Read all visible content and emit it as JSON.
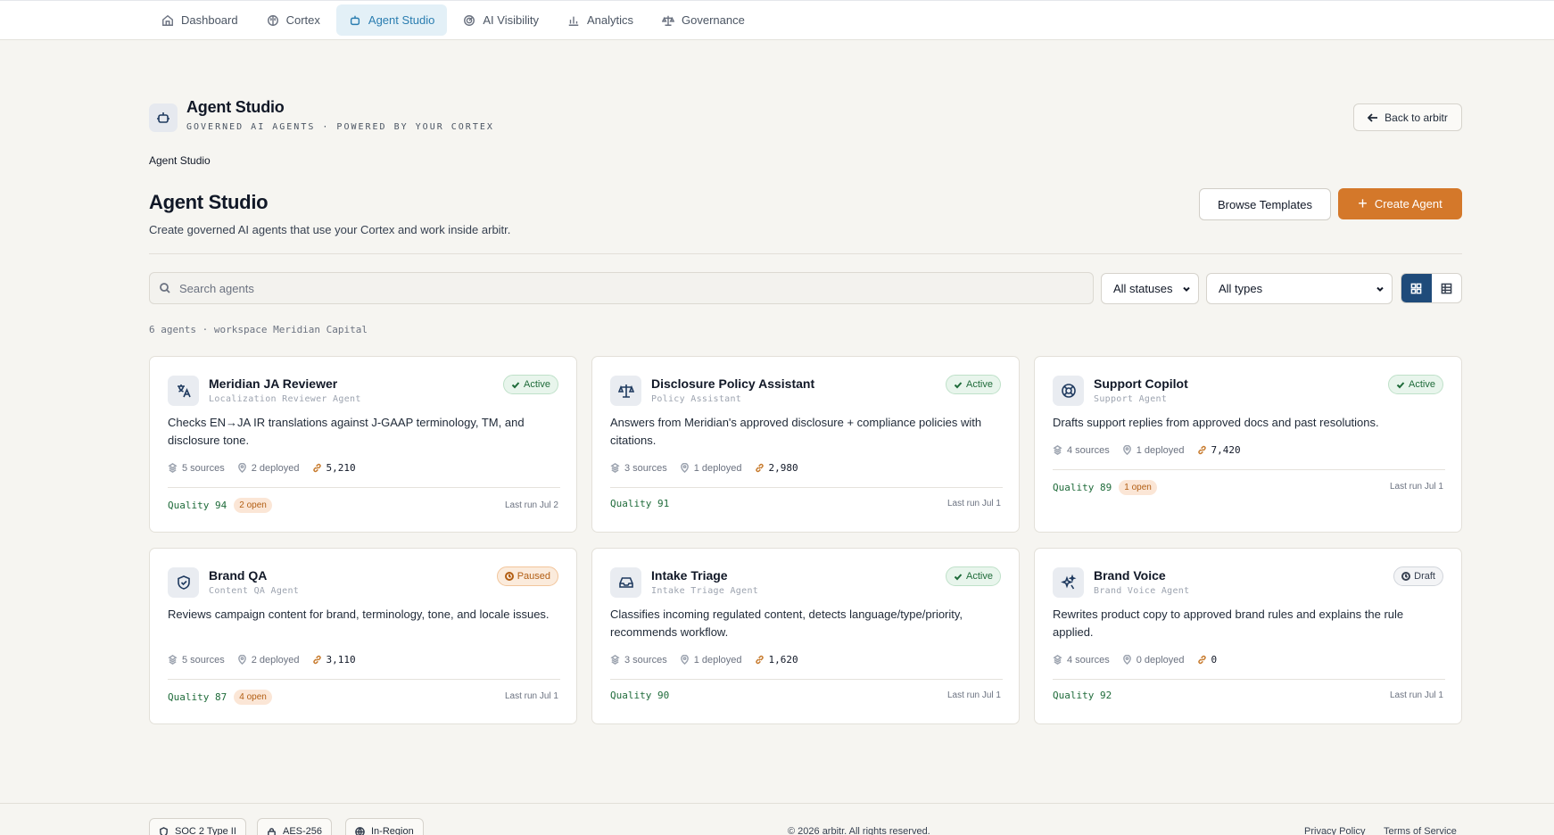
{
  "nav": {
    "items": [
      {
        "label": "Dashboard",
        "icon": "home-icon"
      },
      {
        "label": "Cortex",
        "icon": "brain-icon"
      },
      {
        "label": "Agent Studio",
        "icon": "bot-icon",
        "active": true
      },
      {
        "label": "AI Visibility",
        "icon": "radar-icon"
      },
      {
        "label": "Analytics",
        "icon": "bar-chart-icon"
      },
      {
        "label": "Governance",
        "icon": "scale-icon"
      }
    ]
  },
  "header": {
    "title": "Agent Studio",
    "subtitle": "GOVERNED AI AGENTS · POWERED BY YOUR CORTEX",
    "back_label": "Back to arbitr",
    "breadcrumb": "Agent Studio"
  },
  "main": {
    "title": "Agent Studio",
    "description": "Create governed AI agents that use your Cortex and work inside arbitr.",
    "browse_label": "Browse Templates",
    "create_label": "Create Agent"
  },
  "filters": {
    "search_placeholder": "Search agents",
    "status_value": "All statuses",
    "type_value": "All types",
    "view": "grid"
  },
  "summary": "6 agents · workspace Meridian Capital",
  "agents": [
    {
      "name": "Meridian JA Reviewer",
      "type": "Localization Reviewer Agent",
      "status": "Active",
      "icon": "translate-icon",
      "description": "Checks EN→JA IR translations against J-GAAP terminology, TM, and disclosure tone.",
      "sources": "5 sources",
      "deployed": "2 deployed",
      "runs": "5,210",
      "quality": "Quality 94",
      "open": "2 open",
      "last_run": "Last run Jul 2"
    },
    {
      "name": "Disclosure Policy Assistant",
      "type": "Policy Assistant",
      "status": "Active",
      "icon": "scale-icon",
      "description": "Answers from Meridian's approved disclosure + compliance policies with citations.",
      "sources": "3 sources",
      "deployed": "1 deployed",
      "runs": "2,980",
      "quality": "Quality 91",
      "open": "",
      "last_run": "Last run Jul 1"
    },
    {
      "name": "Support Copilot",
      "type": "Support Agent",
      "status": "Active",
      "icon": "lifebuoy-icon",
      "description": "Drafts support replies from approved docs and past resolutions.",
      "sources": "4 sources",
      "deployed": "1 deployed",
      "runs": "7,420",
      "quality": "Quality 89",
      "open": "1 open",
      "last_run": "Last run Jul 1"
    },
    {
      "name": "Brand QA",
      "type": "Content QA Agent",
      "status": "Paused",
      "icon": "shield-check-icon",
      "description": "Reviews campaign content for brand, terminology, tone, and locale issues.",
      "sources": "5 sources",
      "deployed": "2 deployed",
      "runs": "3,110",
      "quality": "Quality 87",
      "open": "4 open",
      "last_run": "Last run Jul 1"
    },
    {
      "name": "Intake Triage",
      "type": "Intake Triage Agent",
      "status": "Active",
      "icon": "inbox-icon",
      "description": "Classifies incoming regulated content, detects language/type/priority, recommends workflow.",
      "sources": "3 sources",
      "deployed": "1 deployed",
      "runs": "1,620",
      "quality": "Quality 90",
      "open": "",
      "last_run": "Last run Jul 1"
    },
    {
      "name": "Brand Voice",
      "type": "Brand Voice Agent",
      "status": "Draft",
      "icon": "sparkles-icon",
      "description": "Rewrites product copy to approved brand rules and explains the rule applied.",
      "sources": "4 sources",
      "deployed": "0 deployed",
      "runs": "0",
      "quality": "Quality 92",
      "open": "",
      "last_run": "Last run Jul 1"
    }
  ],
  "footer": {
    "badges": [
      "SOC 2 Type II",
      "AES-256",
      "In-Region"
    ],
    "copyright": "© 2026 arbitr. All rights reserved.",
    "privacy": "Privacy Policy",
    "terms": "Terms of Service"
  },
  "colors": {
    "accent": "#d4782a",
    "nav_active": "#2a7db0",
    "active_status": "#1f6b3a",
    "paused_status": "#b25e13"
  }
}
